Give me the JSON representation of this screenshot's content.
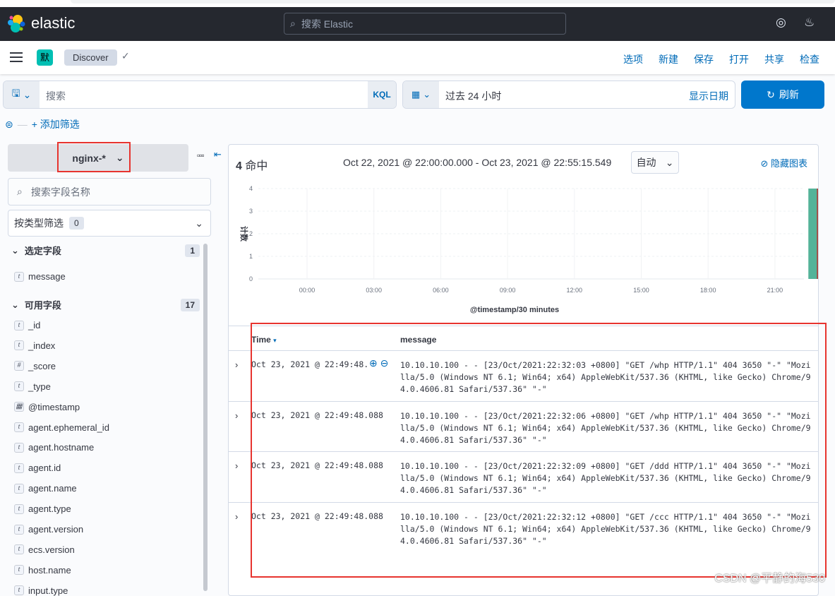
{
  "header": {
    "brand": "elastic",
    "search_placeholder": "搜索 Elastic"
  },
  "nav": {
    "space_initial": "默",
    "breadcrumb": "Discover",
    "menu": [
      "选项",
      "新建",
      "保存",
      "打开",
      "共享",
      "检查"
    ]
  },
  "query": {
    "placeholder": "搜索",
    "language": "KQL"
  },
  "time": {
    "value": "过去 24 小时",
    "show_dates": "显示日期",
    "refresh": "刷新"
  },
  "filters": {
    "add": "+ 添加筛选"
  },
  "sidebar": {
    "index_pattern": "nginx-*",
    "field_search_placeholder": "搜索字段名称",
    "type_filter": "按类型筛选",
    "type_filter_count": "0",
    "selected_title": "选定字段",
    "selected_count": "1",
    "selected": [
      {
        "type": "t",
        "name": "message"
      }
    ],
    "available_title": "可用字段",
    "available_count": "17",
    "available": [
      {
        "type": "t",
        "name": "_id"
      },
      {
        "type": "t",
        "name": "_index"
      },
      {
        "type": "#",
        "name": "_score"
      },
      {
        "type": "t",
        "name": "_type"
      },
      {
        "type": "date",
        "name": "@timestamp"
      },
      {
        "type": "t",
        "name": "agent.ephemeral_id"
      },
      {
        "type": "t",
        "name": "agent.hostname"
      },
      {
        "type": "t",
        "name": "agent.id"
      },
      {
        "type": "t",
        "name": "agent.name"
      },
      {
        "type": "t",
        "name": "agent.type"
      },
      {
        "type": "t",
        "name": "agent.version"
      },
      {
        "type": "t",
        "name": "ecs.version"
      },
      {
        "type": "t",
        "name": "host.name"
      },
      {
        "type": "t",
        "name": "input.type"
      }
    ]
  },
  "main": {
    "hits_count": "4",
    "hits_label": "命中",
    "range": "Oct 22, 2021 @ 22:00:00.000 - Oct 23, 2021 @ 22:55:15.549",
    "interval": "自动",
    "hide_chart": "隐藏图表"
  },
  "chart_data": {
    "type": "bar",
    "ylabel": "计数",
    "xlabel": "@timestamp/30 minutes",
    "yticks": [
      "0",
      "1",
      "2",
      "3",
      "4"
    ],
    "ylim": [
      0,
      4
    ],
    "xticks": [
      "00:00",
      "03:00",
      "06:00",
      "09:00",
      "12:00",
      "15:00",
      "18:00",
      "21:00"
    ],
    "bars": [
      {
        "x": "22:30",
        "value": 4
      }
    ],
    "color": "#54b399",
    "grid": true
  },
  "table": {
    "columns": [
      "Time",
      "message"
    ],
    "rows": [
      {
        "time": "Oct 23, 2021 @ 22:49:48.088",
        "message": "10.10.10.100 - - [23/Oct/2021:22:32:03 +0800] \"GET /whp HTTP/1.1\" 404 3650 \"-\" \"Mozilla/5.0 (Windows NT 6.1; Win64; x64) AppleWebKit/537.36 (KHTML, like Gecko) Chrome/94.0.4606.81 Safari/537.36\" \"-\""
      },
      {
        "time": "Oct 23, 2021 @ 22:49:48.088",
        "message": "10.10.10.100 - - [23/Oct/2021:22:32:06 +0800] \"GET /whp HTTP/1.1\" 404 3650 \"-\" \"Mozilla/5.0 (Windows NT 6.1; Win64; x64) AppleWebKit/537.36 (KHTML, like Gecko) Chrome/94.0.4606.81 Safari/537.36\" \"-\""
      },
      {
        "time": "Oct 23, 2021 @ 22:49:48.088",
        "message": "10.10.10.100 - - [23/Oct/2021:22:32:09 +0800] \"GET /ddd HTTP/1.1\" 404 3650 \"-\" \"Mozilla/5.0 (Windows NT 6.1; Win64; x64) AppleWebKit/537.36 (KHTML, like Gecko) Chrome/94.0.4606.81 Safari/537.36\" \"-\""
      },
      {
        "time": "Oct 23, 2021 @ 22:49:48.088",
        "message": "10.10.10.100 - - [23/Oct/2021:22:32:12 +0800] \"GET /ccc HTTP/1.1\" 404 3650 \"-\" \"Mozilla/5.0 (Windows NT 6.1; Win64; x64) AppleWebKit/537.36 (KHTML, like Gecko) Chrome/94.0.4606.81 Safari/537.36\" \"-\""
      }
    ]
  },
  "watermark": "CSDN @平静的海530"
}
